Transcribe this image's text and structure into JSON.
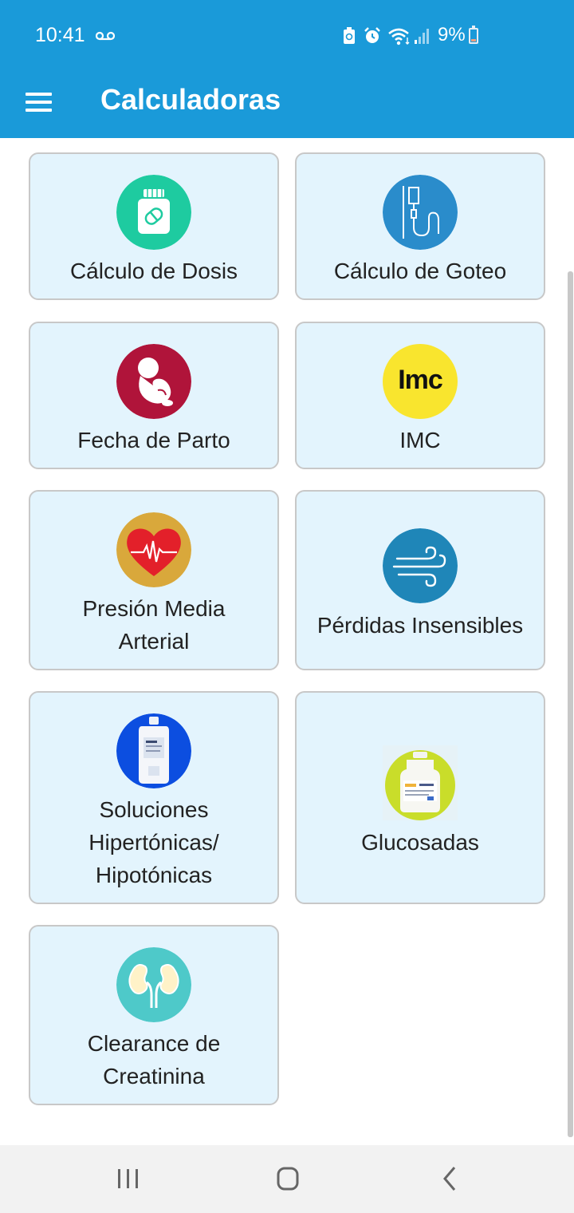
{
  "status_bar": {
    "time": "10:41",
    "battery_percent": "9%",
    "icons": [
      "voicemail-icon",
      "battery-saver-icon",
      "alarm-icon",
      "wifi-icon",
      "signal-icon",
      "battery-icon"
    ]
  },
  "app_bar": {
    "title": "Calculadoras",
    "menu_icon": "hamburger-menu-icon"
  },
  "calculators": [
    {
      "label": "Cálculo de Dosis",
      "icon": "pill-bottle-icon",
      "icon_bg": "#1ecba0"
    },
    {
      "label": "Cálculo de Goteo",
      "icon": "iv-drip-icon",
      "icon_bg": "#2a8ccb"
    },
    {
      "label": "Fecha de Parto",
      "icon": "fetus-icon",
      "icon_bg": "#b0143a"
    },
    {
      "label": "IMC",
      "icon": "imc-icon",
      "icon_bg": "#f9e52e",
      "icon_text": "Imc"
    },
    {
      "label": "Presión Media\nArterial",
      "icon": "heart-pulse-icon",
      "icon_bg": "#d9a83b"
    },
    {
      "label": "Pérdidas Insensibles",
      "icon": "wind-icon",
      "icon_bg": "#1f86b8"
    },
    {
      "label": "Soluciones\nHipertónicas/\nHipotónicas",
      "icon": "saline-bag-icon",
      "icon_bg": "#0c4ee0"
    },
    {
      "label": "Glucosadas",
      "icon": "glucose-bottle-icon",
      "icon_bg": "#c9dd2a"
    },
    {
      "label": "Clearance de\nCreatinina",
      "icon": "kidneys-icon",
      "icon_bg": "#4ec9c9"
    }
  ],
  "nav_bar": {
    "icons": [
      "recent-apps-icon",
      "home-icon",
      "back-icon"
    ]
  }
}
